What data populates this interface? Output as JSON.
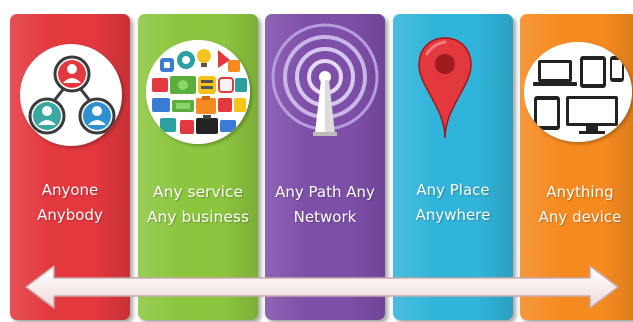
{
  "colors": {
    "panel_red": "#e2383e",
    "panel_green": "#8cc63f",
    "panel_purple": "#7e4fa9",
    "panel_blue": "#31b4da",
    "panel_orange": "#f58a20"
  },
  "panels": [
    {
      "icon": "people-network-icon",
      "line1": "Anyone",
      "line2": "Anybody"
    },
    {
      "icon": "business-services-icon",
      "line1": "Any service",
      "line2": "Any business"
    },
    {
      "icon": "signal-tower-icon",
      "line1": "Any Path Any",
      "line2": "Network"
    },
    {
      "icon": "location-pin-icon",
      "line1": "Any Place",
      "line2": "Anywhere"
    },
    {
      "icon": "devices-icon",
      "line1": "Anything",
      "line2": "Any device"
    }
  ],
  "arrow": {
    "icon": "double-headed-arrow-icon"
  }
}
